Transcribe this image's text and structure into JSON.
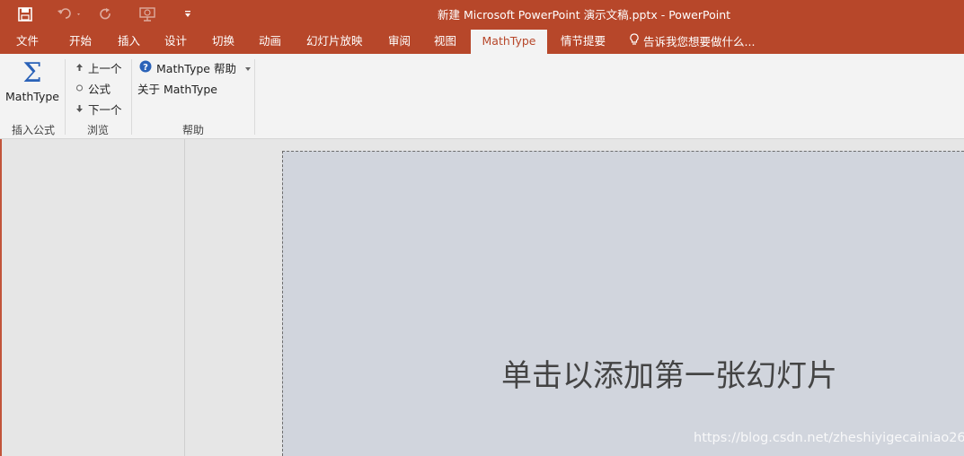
{
  "title": "新建 Microsoft PowerPoint 演示文稿.pptx - PowerPoint",
  "tabs": [
    "文件",
    "开始",
    "插入",
    "设计",
    "切换",
    "动画",
    "幻灯片放映",
    "审阅",
    "视图",
    "MathType",
    "情节提要"
  ],
  "tell_me": "告诉我您想要做什么...",
  "ribbon": {
    "insert_equation": {
      "button": "MathType",
      "group": "插入公式"
    },
    "browse": {
      "prev": "上一个",
      "equation": "公式",
      "next": "下一个",
      "group": "浏览"
    },
    "help": {
      "mathtype_help": "MathType 帮助",
      "about": "关于 MathType",
      "group": "帮助"
    }
  },
  "slide": {
    "placeholder": "单击以添加第一张幻灯片"
  },
  "watermark": "https://blog.csdn.net/zheshiyigecainiao26",
  "colors": {
    "accent": "#b7472a",
    "ribbon_bg": "#f3f3f3",
    "slide_bg": "#d1d5dd"
  }
}
